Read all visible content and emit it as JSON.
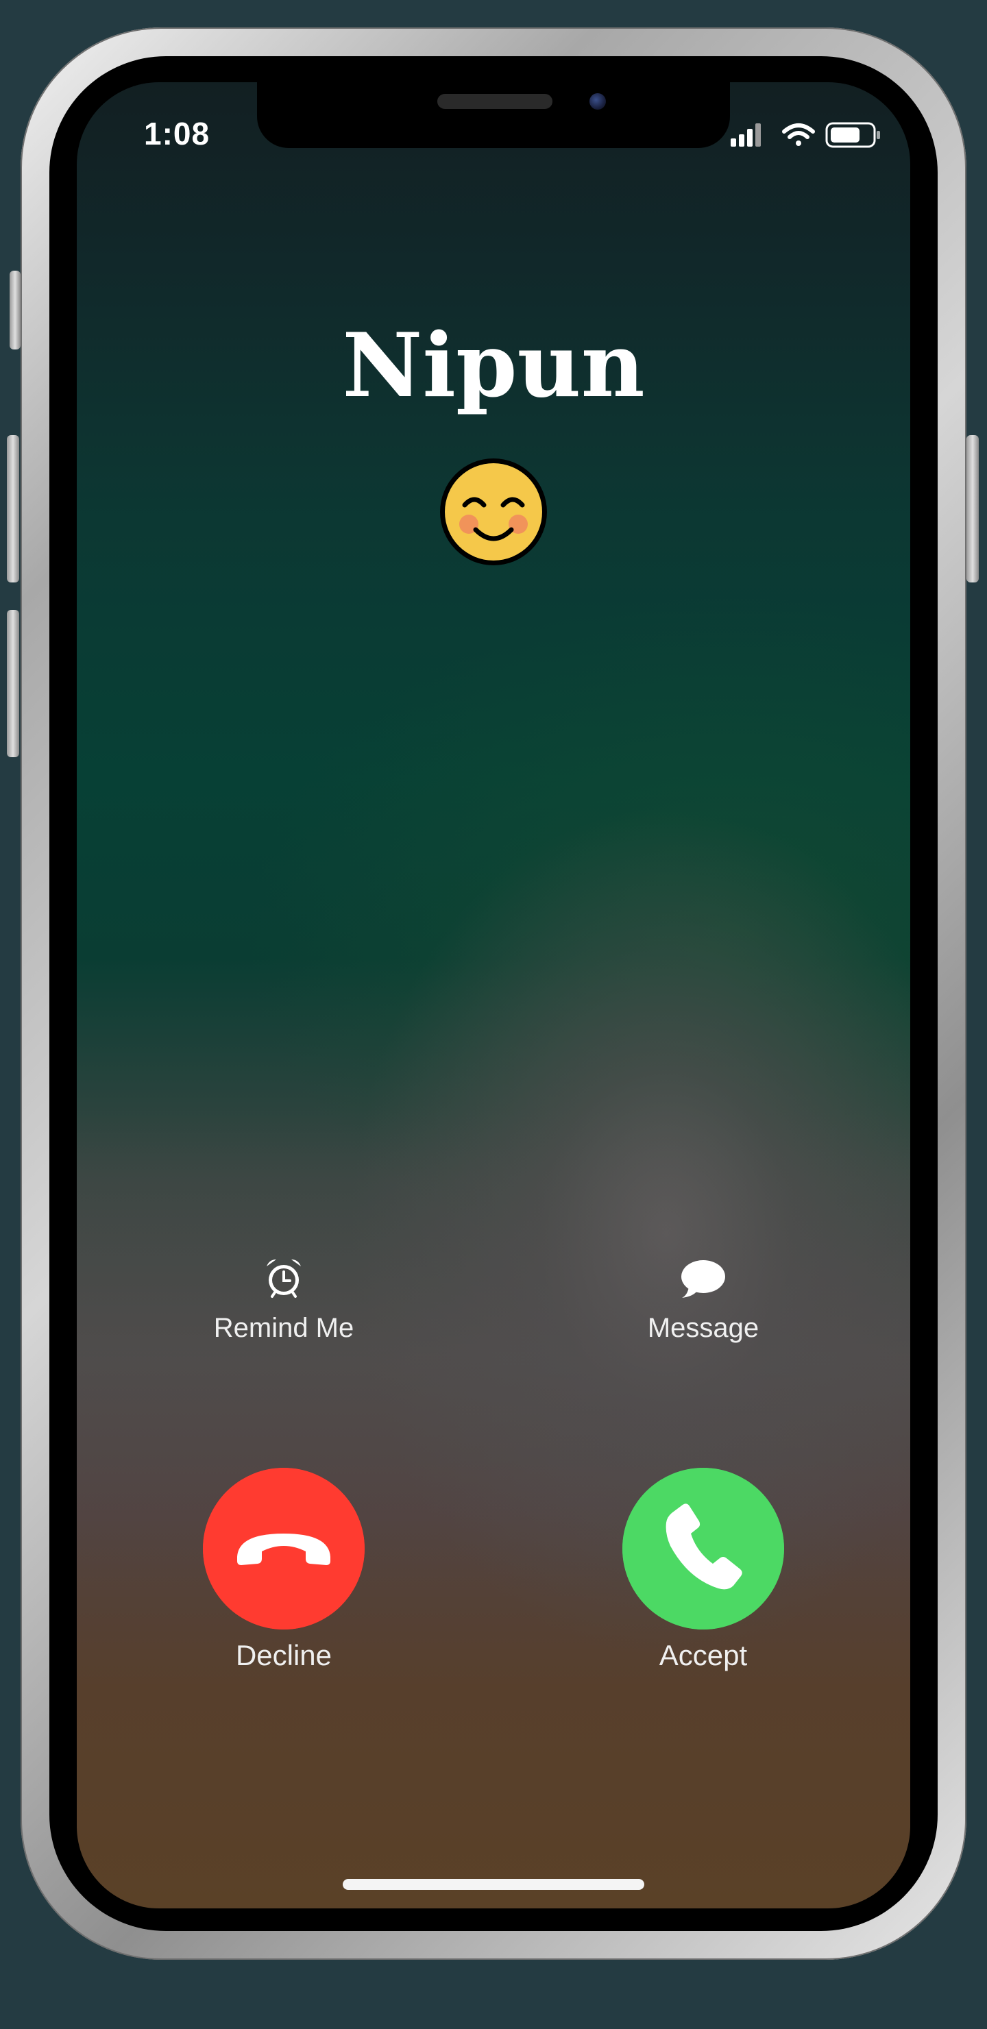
{
  "status_bar": {
    "time": "1:08",
    "signal_icon": "cellular-signal-icon",
    "wifi_icon": "wifi-icon",
    "battery_icon": "battery-icon"
  },
  "caller": {
    "name": "Nipun",
    "emoji": "smiling-face-icon"
  },
  "actions": {
    "remind_label": "Remind Me",
    "remind_icon": "alarm-clock-icon",
    "message_label": "Message",
    "message_icon": "speech-bubble-icon"
  },
  "call_buttons": {
    "decline_label": "Decline",
    "decline_color": "#ff3b30",
    "accept_label": "Accept",
    "accept_color": "#4cd964"
  },
  "colors": {
    "background": "#243b42",
    "text": "#ffffff"
  }
}
